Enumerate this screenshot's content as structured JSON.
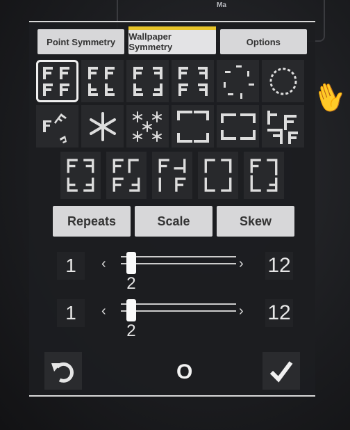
{
  "background": {
    "corner_label": "Ma"
  },
  "tabs": [
    {
      "label": "Point Symmetry",
      "active": false
    },
    {
      "label": "Wallpaper Symmetry",
      "active": true
    },
    {
      "label": "Options",
      "active": false
    }
  ],
  "symmetry_options": {
    "selected_index": 0,
    "row_1": [
      "p1",
      "pm",
      "pg",
      "cm",
      "p4",
      "p8"
    ],
    "row_2": [
      "p3",
      "p6",
      "p6m",
      "p4m",
      "p4g",
      "pgg"
    ],
    "row_3": [
      "pmm",
      "pmg",
      "p2",
      "cmm",
      "p31m"
    ]
  },
  "buttons": {
    "repeats": "Repeats",
    "scale": "Scale",
    "skew": "Skew"
  },
  "sliders": [
    {
      "min": "1",
      "max": "12",
      "value": "2",
      "fraction": 0.09
    },
    {
      "min": "1",
      "max": "12",
      "value": "2",
      "fraction": 0.09
    }
  ],
  "footer": {
    "undo_icon": "undo-icon",
    "center_label": "O",
    "confirm_icon": "check-icon"
  },
  "colors": {
    "tab_accent": "#e7c42a",
    "button_bg": "#d7d7d9",
    "panel_bg": "#1c1d20"
  }
}
